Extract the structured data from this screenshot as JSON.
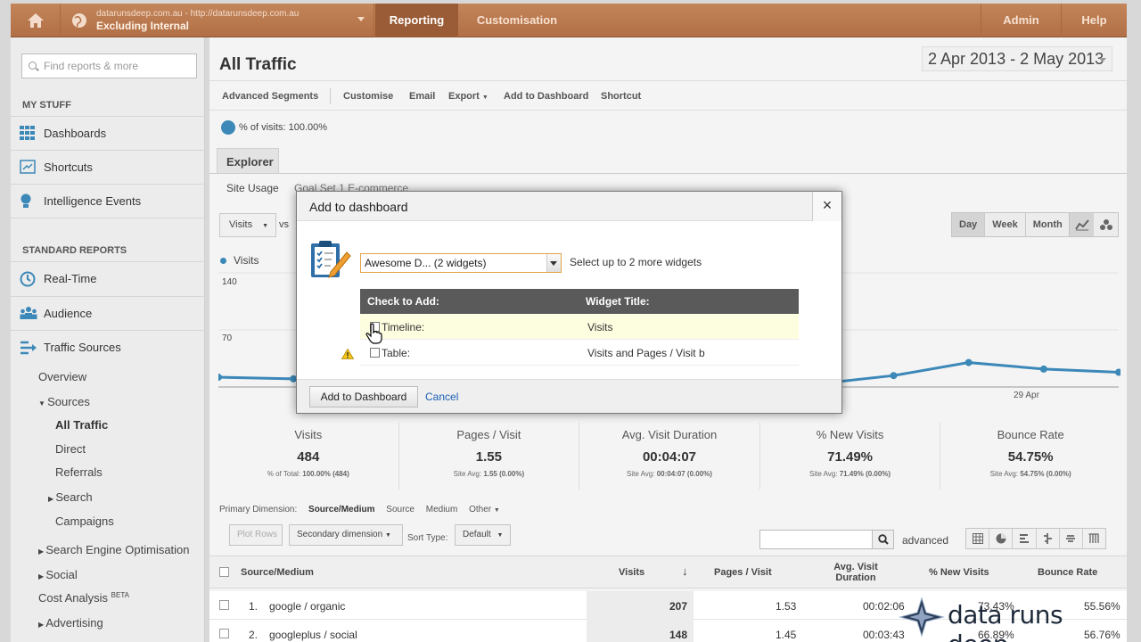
{
  "topbar": {
    "account_line1": "datarunsdeep.com.au - http://datarunsdeep.com.au",
    "account_line2": "Excluding Internal",
    "nav": [
      {
        "label": "Reporting",
        "active": true
      },
      {
        "label": "Customisation",
        "active": false
      },
      {
        "label": "Admin",
        "active": false
      },
      {
        "label": "Help",
        "active": false
      }
    ]
  },
  "sidebar": {
    "search_placeholder": "Find reports & more",
    "my_stuff": "MY STUFF",
    "my_items": [
      "Dashboards",
      "Shortcuts",
      "Intelligence Events"
    ],
    "standard_reports": "STANDARD REPORTS",
    "std_items": [
      "Real-Time",
      "Audience",
      "Traffic Sources"
    ],
    "sub": {
      "overview": "Overview",
      "sources": "Sources",
      "all_traffic": "All Traffic",
      "direct": "Direct",
      "referrals": "Referrals",
      "search": "Search",
      "campaigns": "Campaigns",
      "seo": "Search Engine Optimisation",
      "social": "Social",
      "cost_analysis": "Cost Analysis",
      "beta": "BETA",
      "advertising": "Advertising"
    }
  },
  "main": {
    "title": "All Traffic",
    "date_range": "2 Apr 2013 - 2 May 2013",
    "toolbar": [
      "Advanced Segments",
      "Customise",
      "Email",
      "Export",
      "Add to Dashboard",
      "Shortcut"
    ],
    "segment": "% of visits: 100.00%",
    "explorer_tab": "Explorer",
    "site_usage": "Site Usage",
    "site_tabs_rest": "Goal Set 1   E-commerce",
    "metric_select": "Visits",
    "vs": "vs",
    "legend": "Visits",
    "y_max": "140",
    "y_mid": "70",
    "period_buttons": [
      "Day",
      "Week",
      "Month"
    ],
    "x_tick": "29 Apr",
    "cards": [
      {
        "title": "Visits",
        "value": "484",
        "sub_label": "% of Total:",
        "sub_value": "100.00% (484)"
      },
      {
        "title": "Pages / Visit",
        "value": "1.55",
        "sub_label": "Site Avg:",
        "sub_value": "1.55 (0.00%)"
      },
      {
        "title": "Avg. Visit Duration",
        "value": "00:04:07",
        "sub_label": "Site Avg:",
        "sub_value": "00:04:07 (0.00%)"
      },
      {
        "title": "% New Visits",
        "value": "71.49%",
        "sub_label": "Site Avg:",
        "sub_value": "71.49% (0.00%)"
      },
      {
        "title": "Bounce Rate",
        "value": "54.75%",
        "sub_label": "Site Avg:",
        "sub_value": "54.75% (0.00%)"
      }
    ],
    "primary_dimension": {
      "label": "Primary Dimension:",
      "selected": "Source/Medium",
      "others": [
        "Source",
        "Medium",
        "Other"
      ]
    },
    "controls": {
      "plot_rows": "Plot Rows",
      "secondary": "Secondary dimension",
      "sort_type": "Sort Type:",
      "sort_value": "Default",
      "advanced": "advanced"
    },
    "table": {
      "headers": [
        "Source/Medium",
        "Visits",
        "Pages / Visit",
        "Avg. Visit Duration",
        "% New Visits",
        "Bounce Rate"
      ],
      "rows": [
        {
          "num": "1.",
          "source": "google / organic",
          "visits": "207",
          "ppv": "1.53",
          "dur": "00:02:06",
          "newv": "73.43%",
          "bounce": "55.56%"
        },
        {
          "num": "2.",
          "source": "googleplus / social",
          "visits": "148",
          "ppv": "1.45",
          "dur": "00:03:43",
          "newv": "66.89%",
          "bounce": "56.76%"
        }
      ]
    }
  },
  "modal": {
    "title": "Add to dashboard",
    "close": "×",
    "dashboard_select": "Awesome D...  (2 widgets)",
    "hint": "Select up to 2 more widgets",
    "col_check": "Check to Add:",
    "col_title": "Widget Title:",
    "rows": [
      {
        "label": "Timeline:",
        "title": "Visits"
      },
      {
        "label": "Table:",
        "title": "Visits and Pages / Visit b"
      }
    ],
    "add_button": "Add to Dashboard",
    "cancel": "Cancel"
  },
  "watermark": "data runs deep",
  "chart_data": {
    "type": "line",
    "title": "",
    "series": [
      {
        "name": "Visits",
        "values": [
          12,
          10,
          14,
          100,
          40,
          18,
          26,
          12,
          4,
          14,
          30,
          22,
          18
        ]
      }
    ],
    "ylim": [
      0,
      140
    ],
    "x_tick_label": "29 Apr"
  },
  "colors": {
    "topbar": "#b8764c",
    "accent": "#3c88b8",
    "link": "#1a5fb4",
    "highlight": "#fdfde0"
  }
}
